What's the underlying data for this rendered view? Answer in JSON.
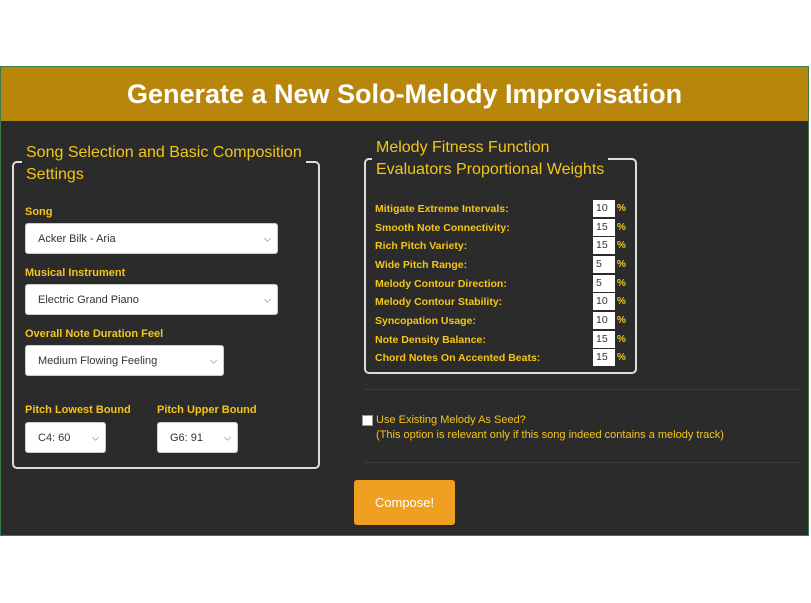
{
  "header": {
    "title": "Generate a New Solo-Melody Improvisation"
  },
  "song_settings": {
    "legend_line1": "Song Selection and Basic Composition",
    "legend_line2": "Settings",
    "song_label": "Song",
    "song_value": "Acker Bilk - Aria",
    "instrument_label": "Musical Instrument",
    "instrument_value": "Electric Grand Piano",
    "duration_label": "Overall Note Duration Feel",
    "duration_value": "Medium Flowing Feeling",
    "pitch_low_label": "Pitch Lowest Bound",
    "pitch_low_value": "C4: 60",
    "pitch_high_label": "Pitch Upper Bound",
    "pitch_high_value": "G6: 91"
  },
  "fitness": {
    "legend_line1": "Melody Fitness Function",
    "legend_line2": "Evaluators Proportional Weights",
    "percent_sign": "%",
    "rows": [
      {
        "label": "Mitigate Extreme Intervals:",
        "value": "10"
      },
      {
        "label": "Smooth Note Connectivity:",
        "value": "15"
      },
      {
        "label": "Rich Pitch Variety:",
        "value": "15"
      },
      {
        "label": "Wide Pitch Range:",
        "value": "5"
      },
      {
        "label": "Melody Contour Direction:",
        "value": "5"
      },
      {
        "label": "Melody Contour Stability:",
        "value": "10"
      },
      {
        "label": "Syncopation Usage:",
        "value": "10"
      },
      {
        "label": "Note Density Balance:",
        "value": "15"
      },
      {
        "label": "Chord Notes On Accented Beats:",
        "value": "15"
      }
    ]
  },
  "seed": {
    "label": "Use Existing Melody As Seed?",
    "note": "(This option is relevant only if this song indeed contains a melody track)",
    "checked": false
  },
  "compose_button": "Compose!",
  "icons": {
    "select_chevron": "chevron-down-icon",
    "checkbox": "checkbox-icon"
  },
  "colors": {
    "header_bg": "#b8860b",
    "panel_bg": "#2b2b2b",
    "accent_text": "#f5c518",
    "compose_bg": "#f0a020"
  }
}
